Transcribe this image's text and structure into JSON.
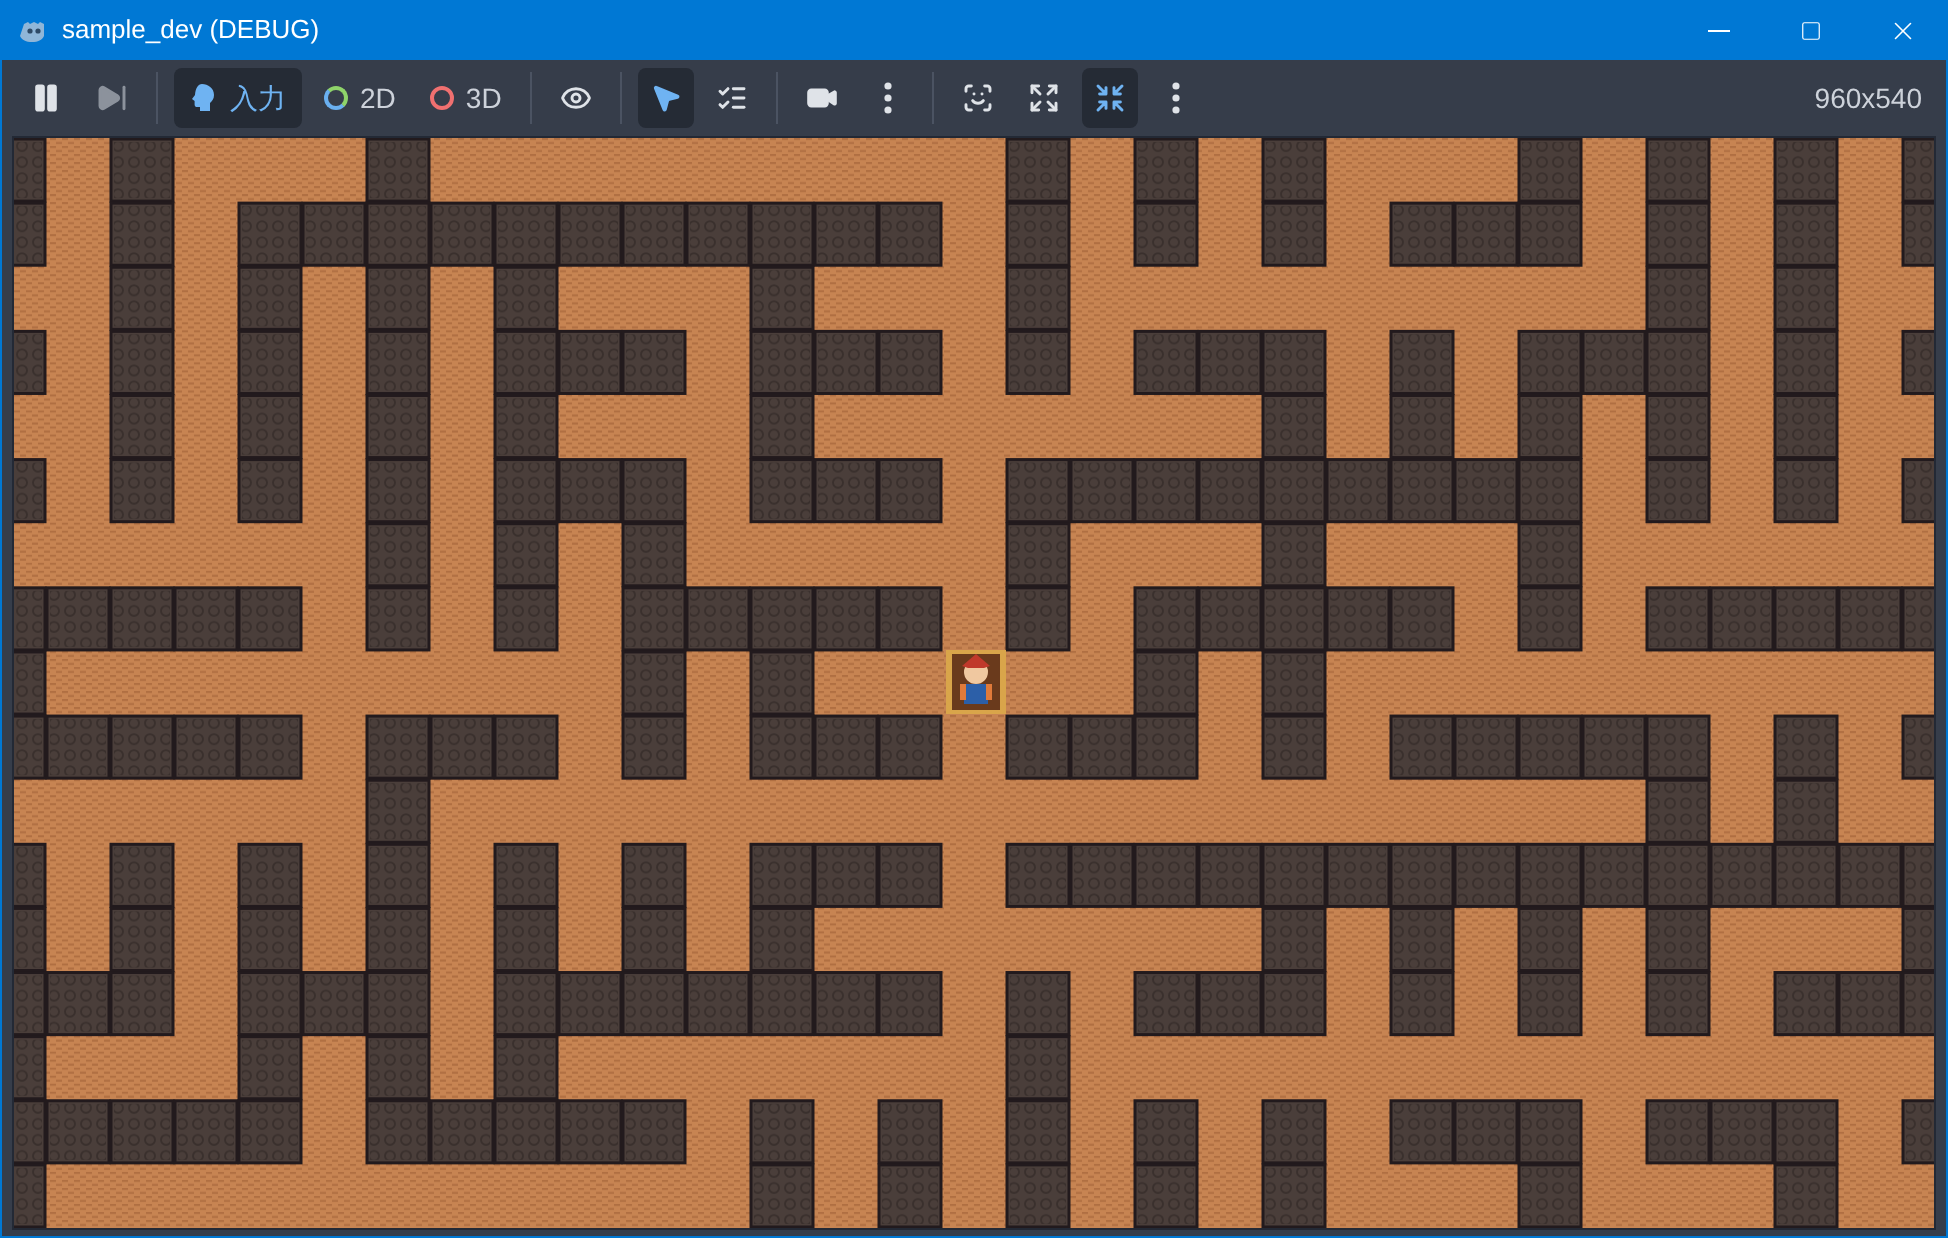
{
  "window": {
    "title": "sample_dev (DEBUG)"
  },
  "toolbar": [
    {
      "kind": "pause",
      "selected": false
    },
    {
      "kind": "step",
      "selected": false
    },
    {
      "kind": "divider"
    },
    {
      "kind": "input",
      "label": "入力",
      "selected": true
    },
    {
      "kind": "mode2d",
      "label": "2D",
      "selected": false
    },
    {
      "kind": "mode3d",
      "label": "3D",
      "selected": false
    },
    {
      "kind": "divider"
    },
    {
      "kind": "visibility",
      "selected": false
    },
    {
      "kind": "divider"
    },
    {
      "kind": "select",
      "selected": true
    },
    {
      "kind": "list_select",
      "selected": false
    },
    {
      "kind": "divider"
    },
    {
      "kind": "camera",
      "selected": false
    },
    {
      "kind": "more",
      "selected": false
    },
    {
      "kind": "divider"
    },
    {
      "kind": "lock_frame",
      "selected": false
    },
    {
      "kind": "expand",
      "selected": false
    },
    {
      "kind": "fit",
      "selected": true
    },
    {
      "kind": "more",
      "selected": false
    }
  ],
  "resolution": "960x540"
}
